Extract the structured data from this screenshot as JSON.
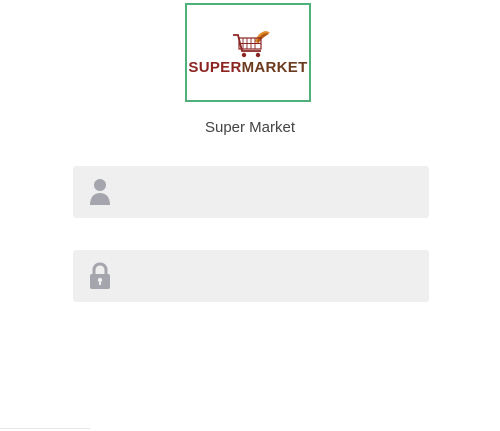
{
  "logo": {
    "text_part1": "SUPER",
    "text_part2": "MARKET"
  },
  "app_name": "Super Market",
  "login_form": {
    "username_field": {
      "placeholder": "",
      "value": "",
      "icon": "user-icon"
    },
    "password_field": {
      "placeholder": "",
      "value": "",
      "icon": "lock-icon"
    },
    "submit_button": {
      "label": ""
    }
  },
  "colors": {
    "logo_border": "#4fb07a",
    "field_background": "#efefef",
    "icon": "#a5a5ad"
  }
}
